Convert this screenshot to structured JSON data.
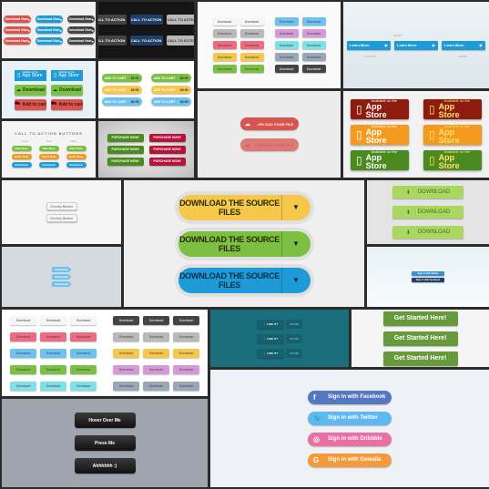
{
  "colors": {
    "red": "#d9534f",
    "blue": "#1e9bd7",
    "dark": "#444",
    "navy": "#1f3f66",
    "green": "#7cc043",
    "yellow": "#f5c84c",
    "pink": "#f06a80",
    "cyan": "#7fe0ea",
    "purple": "#d79ad8",
    "slate": "#98a8b8",
    "gray": "#b9b9b9",
    "white": "#f6f6f6",
    "orange": "#f39a1f",
    "darkred": "#8e1c0e",
    "darkgreen": "#4a8a1e",
    "lightblue": "#6ec2ef",
    "facebook": "#5578c0",
    "twitter": "#5fb8f0",
    "dribbble": "#ea6fa2",
    "gowalla": "#f49a3a",
    "teal": "#1b6e7c",
    "olive": "#6a9e3a"
  },
  "p1": {
    "label": "Download Now",
    "rows": [
      [
        "red",
        "blue",
        "dark"
      ],
      [
        "red",
        "blue",
        "dark"
      ],
      [
        "red",
        "blue",
        "dark"
      ]
    ]
  },
  "p2": {
    "label": "CALL TO ACTION",
    "rows": [
      [
        "dark",
        "navy",
        "gray"
      ],
      [
        "dark",
        "navy",
        "gray"
      ]
    ]
  },
  "p3": {
    "label": "Download",
    "rows": [
      [
        "white",
        "white",
        "lightblue",
        "lightblue"
      ],
      [
        "gray",
        "gray",
        "purple",
        "purple"
      ],
      [
        "pink",
        "pink",
        "cyan",
        "cyan"
      ],
      [
        "yellow",
        "yellow",
        "slate",
        "slate"
      ],
      [
        "green",
        "green",
        "dark",
        "dark"
      ]
    ]
  },
  "p4": {
    "label": "Learn More",
    "states": [
      "hover",
      "normal",
      "active"
    ]
  },
  "p5": {
    "small": "Available on the",
    "app": "App Store",
    "download": "Download",
    "cart": "Add to cart"
  },
  "p6": {
    "label": "ADD TO CART",
    "price": "$9.99",
    "rows": [
      "green",
      "yellow",
      "lightblue"
    ]
  },
  "p7": {
    "label": "UPLOAD YOUR FILE"
  },
  "p8": {
    "small": "Available on the",
    "app": "App Store",
    "rows": [
      "darkred",
      "orange",
      "darkgreen"
    ]
  },
  "p9": {
    "title": "CALL TO ACTION BUTTONS",
    "headers": [
      "normal",
      "hover",
      "active"
    ],
    "rows": [
      {
        "label": "Start Now",
        "color": "green"
      },
      {
        "label": "Order Now",
        "color": "orange"
      },
      {
        "label": "Download",
        "color": "blue"
      }
    ]
  },
  "p10": {
    "label": "PURCHASE NOW!"
  },
  "p11": {
    "label": "Chunky Button"
  },
  "p12": {
    "label": "DOWNLOAD THE SOURCE FILES",
    "rows": [
      "yellow",
      "green",
      "blue"
    ]
  },
  "p13": {
    "label": "DOWNLOAD"
  },
  "p14": {
    "label": "Download"
  },
  "p15": {
    "twitter": "Sign in with Twitter",
    "facebook": "Sign in with Facebook"
  },
  "p16": {
    "label": "Download",
    "left": [
      "white",
      "pink",
      "lightblue",
      "green",
      "cyan"
    ],
    "right": [
      "dark",
      "gray",
      "yellow",
      "purple",
      "slate"
    ]
  },
  "p17": {
    "like": "LIKE IT?",
    "count": "20 233"
  },
  "p18": {
    "label": "Get Started Here!"
  },
  "p19": {
    "items": [
      {
        "label": "Sign in with Facebook",
        "color": "facebook",
        "icon": "f"
      },
      {
        "label": "Sign in with Twitter",
        "color": "twitter",
        "icon": "🐦"
      },
      {
        "label": "Sign in with Dribbble",
        "color": "dribbble",
        "icon": "◎"
      },
      {
        "label": "Sign in with Gowalla",
        "color": "gowalla",
        "icon": "G"
      }
    ]
  },
  "p20": {
    "items": [
      "Hover Over Me",
      "Press Me",
      "Ahhhhhh :)"
    ]
  }
}
